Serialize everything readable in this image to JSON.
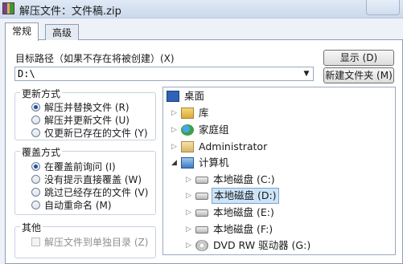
{
  "window": {
    "title": "解压文件：文件稿.zip"
  },
  "tabs": [
    {
      "label": "常规"
    },
    {
      "label": "高级"
    }
  ],
  "target": {
    "label": "目标路径（如果不存在将被创建）(X)",
    "value": "D:\\",
    "show_button": "显示 (D)",
    "new_folder_button": "新建文件夹 (M)"
  },
  "update_mode": {
    "title": "更新方式",
    "options": [
      {
        "label": "解压并替换文件 (R)",
        "selected": true
      },
      {
        "label": "解压并更新文件 (U)",
        "selected": false
      },
      {
        "label": "仅更新已存在的文件 (Y)",
        "selected": false
      }
    ]
  },
  "overwrite_mode": {
    "title": "覆盖方式",
    "options": [
      {
        "label": "在覆盖前询问 (I)",
        "selected": true
      },
      {
        "label": "没有提示直接覆盖 (W)",
        "selected": false
      },
      {
        "label": "跳过已经存在的文件 (V)",
        "selected": false
      },
      {
        "label": "自动重命名 (M)",
        "selected": false
      }
    ]
  },
  "misc": {
    "title": "其他",
    "options": [
      {
        "label": "解压文件到单独目录 (Z)"
      }
    ]
  },
  "tree": {
    "desktop": "桌面",
    "library": "库",
    "homegroup": "家庭组",
    "user": "Administrator",
    "computer": "计算机",
    "drives": [
      {
        "label": "本地磁盘 (C:)"
      },
      {
        "label": "本地磁盘 (D:)"
      },
      {
        "label": "本地磁盘 (E:)"
      },
      {
        "label": "本地磁盘 (F:)"
      },
      {
        "label": "DVD RW 驱动器 (G:)"
      }
    ]
  },
  "colors": {
    "selection": "#cce4f7",
    "selection_border": "#7da2ce",
    "title_bar": "#cbd9ec"
  },
  "icons": {
    "window": "winrar-icon",
    "desktop": "desktop-icon",
    "library": "library-icon",
    "homegroup": "homegroup-icon",
    "user": "user-folder-icon",
    "computer": "computer-icon",
    "drive": "drive-icon",
    "dvd": "dvd-drive-icon"
  }
}
